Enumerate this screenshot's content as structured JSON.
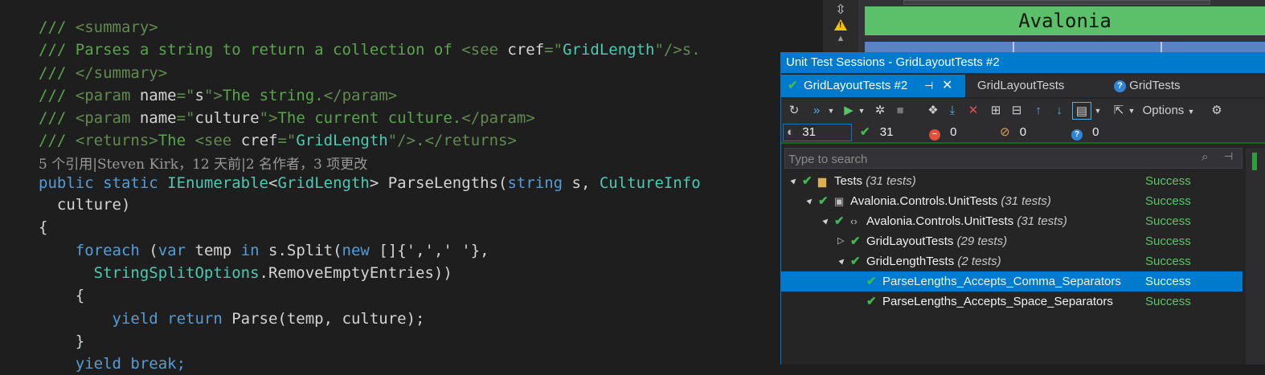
{
  "editor": {
    "lines": [
      [
        {
          "t": "/// ",
          "c": "cm"
        },
        {
          "t": "<summary>",
          "c": "xt"
        }
      ],
      [
        {
          "t": "/// ",
          "c": "cm"
        },
        {
          "t": "Parses a string to return a collection of ",
          "c": "cm"
        },
        {
          "t": "<see ",
          "c": "xt"
        },
        {
          "t": "cref",
          "c": "pl"
        },
        {
          "t": "=\"",
          "c": "xt"
        },
        {
          "t": "GridLength",
          "c": "ty"
        },
        {
          "t": "\"/>s.",
          "c": "xt"
        }
      ],
      [
        {
          "t": "/// ",
          "c": "cm"
        },
        {
          "t": "</summary>",
          "c": "xt"
        }
      ],
      [
        {
          "t": "/// ",
          "c": "cm"
        },
        {
          "t": "<param ",
          "c": "xt"
        },
        {
          "t": "name",
          "c": "pl"
        },
        {
          "t": "=\"",
          "c": "xt"
        },
        {
          "t": "s",
          "c": "pl"
        },
        {
          "t": "\">",
          "c": "xt"
        },
        {
          "t": "The string.",
          "c": "cm"
        },
        {
          "t": "</param>",
          "c": "xt"
        }
      ],
      [
        {
          "t": "/// ",
          "c": "cm"
        },
        {
          "t": "<param ",
          "c": "xt"
        },
        {
          "t": "name",
          "c": "pl"
        },
        {
          "t": "=\"",
          "c": "xt"
        },
        {
          "t": "culture",
          "c": "pl"
        },
        {
          "t": "\">",
          "c": "xt"
        },
        {
          "t": "The current culture.",
          "c": "cm"
        },
        {
          "t": "</param>",
          "c": "xt"
        }
      ],
      [
        {
          "t": "/// ",
          "c": "cm"
        },
        {
          "t": "<returns>",
          "c": "xt"
        },
        {
          "t": "The ",
          "c": "cm"
        },
        {
          "t": "<see ",
          "c": "xt"
        },
        {
          "t": "cref",
          "c": "pl"
        },
        {
          "t": "=\"",
          "c": "xt"
        },
        {
          "t": "GridLength",
          "c": "ty"
        },
        {
          "t": "\"/>",
          "c": "xt"
        },
        {
          "t": ".",
          "c": "cm"
        },
        {
          "t": "</returns>",
          "c": "xt"
        }
      ],
      [
        {
          "t": "5 个引用|Steven Kirk，12 天前|2 名作者，3 项更改",
          "c": "lens"
        }
      ],
      [
        {
          "t": "public ",
          "c": "kw"
        },
        {
          "t": "static ",
          "c": "kw"
        },
        {
          "t": "IEnumerable",
          "c": "ty"
        },
        {
          "t": "<",
          "c": "pl"
        },
        {
          "t": "GridLength",
          "c": "ty"
        },
        {
          "t": "> ParseLengths(",
          "c": "pl"
        },
        {
          "t": "string ",
          "c": "kw"
        },
        {
          "t": "s, ",
          "c": "pl"
        },
        {
          "t": "CultureInfo",
          "c": "ty"
        }
      ],
      [
        {
          "t": "  culture)",
          "c": "pl"
        }
      ],
      [
        {
          "t": "{",
          "c": "pl"
        }
      ],
      [
        {
          "t": "    ",
          "c": "pl"
        },
        {
          "t": "foreach ",
          "c": "kw"
        },
        {
          "t": "(",
          "c": "pl"
        },
        {
          "t": "var ",
          "c": "kw"
        },
        {
          "t": "temp ",
          "c": "pl"
        },
        {
          "t": "in ",
          "c": "kw"
        },
        {
          "t": "s.Split(",
          "c": "pl"
        },
        {
          "t": "new ",
          "c": "kw"
        },
        {
          "t": "[]{','",
          "c": "pl"
        },
        {
          "t": ",' '},",
          "c": "pl"
        }
      ],
      [
        {
          "t": "      StringSplitOptions",
          "c": "ty"
        },
        {
          "t": ".RemoveEmptyEntries))",
          "c": "pl"
        }
      ],
      [
        {
          "t": "    {",
          "c": "pl"
        }
      ],
      [
        {
          "t": "        ",
          "c": "pl"
        },
        {
          "t": "yield ",
          "c": "kw"
        },
        {
          "t": "return ",
          "c": "kw"
        },
        {
          "t": "Parse(temp, culture);",
          "c": "pl"
        }
      ],
      [
        {
          "t": "    }",
          "c": "pl"
        }
      ],
      [
        {
          "t": "    ",
          "c": "pl"
        },
        {
          "t": "yield break;",
          "c": "kw"
        }
      ]
    ]
  },
  "designer": {
    "title": "Avalonia"
  },
  "panel": {
    "title": "Unit Test Sessions - GridLayoutTests #2",
    "tabs": [
      {
        "label": "GridLayoutTests #2",
        "icon": "check-icon",
        "active": true
      },
      {
        "label": "GridLayoutTests",
        "active": false
      },
      {
        "label": "GridTests",
        "icon": "question-icon",
        "active": false
      }
    ],
    "toolbar": {
      "options_label": "Options"
    },
    "counts": {
      "total": "31",
      "passed": "31",
      "failed": "0",
      "ignored": "0",
      "inconclusive": "0"
    },
    "search_placeholder": "Type to search",
    "rows": [
      {
        "indent": 0,
        "expander": "▲",
        "icon": "folder-icon",
        "name": "Tests",
        "count": "(31 tests)",
        "status": "Success",
        "selected": false
      },
      {
        "indent": 1,
        "expander": "▲",
        "icon": "csharp-project-icon",
        "name": "Avalonia.Controls.UnitTests",
        "count": "(31 tests)",
        "status": "Success",
        "selected": false
      },
      {
        "indent": 2,
        "expander": "▲",
        "icon": "namespace-icon",
        "name": "Avalonia.Controls.UnitTests",
        "count": "(31 tests)",
        "status": "Success",
        "selected": false
      },
      {
        "indent": 3,
        "expander": "▷",
        "icon": "",
        "name": "GridLayoutTests",
        "count": "(29 tests)",
        "status": "Success",
        "selected": false
      },
      {
        "indent": 3,
        "expander": "▲",
        "icon": "",
        "name": "GridLengthTests",
        "count": "(2 tests)",
        "status": "Success",
        "selected": false
      },
      {
        "indent": 4,
        "expander": "",
        "icon": "",
        "name": "ParseLengths_Accepts_Comma_Separators",
        "count": "",
        "status": "Success",
        "selected": true
      },
      {
        "indent": 4,
        "expander": "",
        "icon": "",
        "name": "ParseLengths_Accepts_Space_Separators",
        "count": "",
        "status": "Success",
        "selected": false
      }
    ]
  }
}
